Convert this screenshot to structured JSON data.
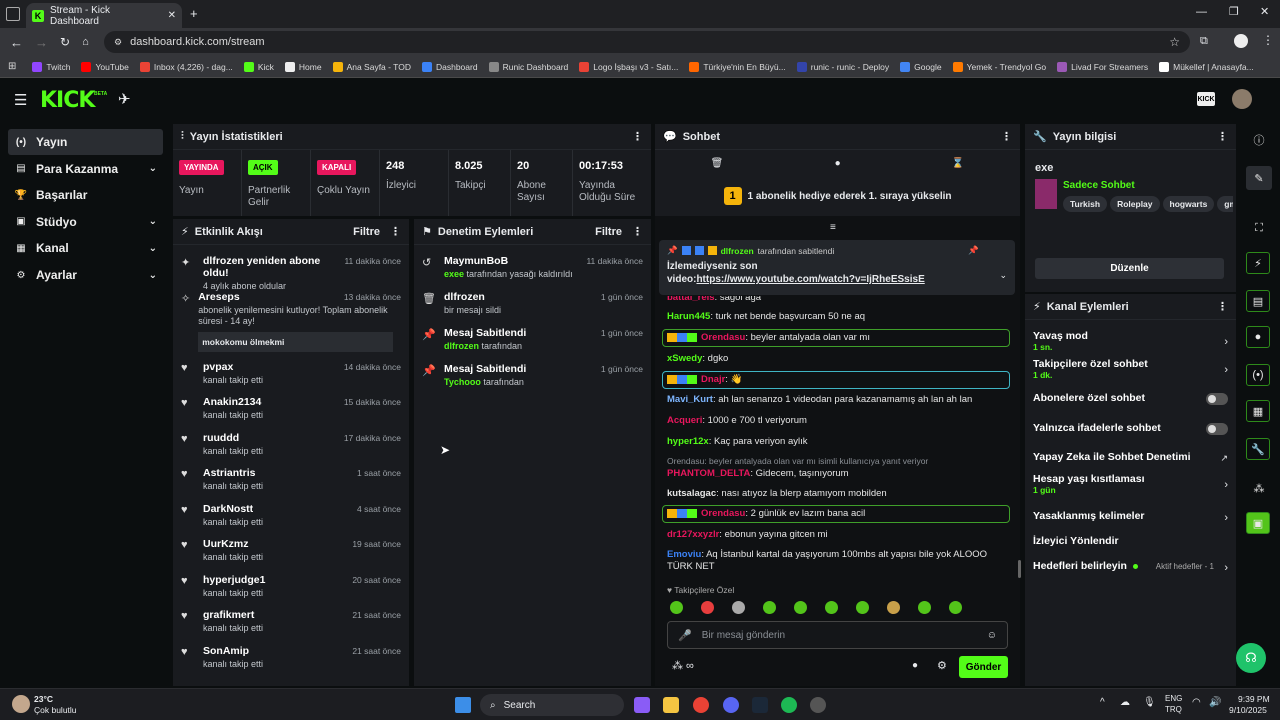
{
  "browser": {
    "tab_title": "Stream - Kick Dashboard",
    "url": "dashboard.kick.com/stream",
    "bookmarks": [
      "Twitch",
      "YouTube",
      "Inbox (4,226) - dag...",
      "Kick",
      "Home",
      "Ana Sayfa - TOD",
      "Dashboard",
      "Runic Dashboard",
      "Logo İşbaşı v3 - Satı...",
      "Türkiye'nin En Büyü...",
      "runic - runic - Deploy",
      "Google",
      "Yemek - Trendyol Go",
      "Livad For Streamers",
      "Mükellef | Anasayfa..."
    ]
  },
  "app": {
    "logo": "KICK",
    "beta": "BETA"
  },
  "sidebar": [
    {
      "label": "Yayın",
      "icon": "broadcast-icon"
    },
    {
      "label": "Para Kazanma",
      "icon": "money-icon"
    },
    {
      "label": "Başarılar",
      "icon": "trophy-icon"
    },
    {
      "label": "Stüdyo",
      "icon": "studio-icon"
    },
    {
      "label": "Kanal",
      "icon": "channel-icon"
    },
    {
      "label": "Ayarlar",
      "icon": "gear-icon"
    }
  ],
  "stats": {
    "title": "Yayın İstatistikleri",
    "items": [
      {
        "badge": "YAYINDA",
        "label": "Yayın",
        "color": "#e8175d"
      },
      {
        "badge": "AÇIK",
        "label": "Partnerlik Gelir",
        "color": "#53fc18"
      },
      {
        "badge": "KAPALI",
        "label": "Çoklu Yayın",
        "color": "#e8175d"
      },
      {
        "value": "248",
        "label": "İzleyici"
      },
      {
        "value": "8.025",
        "label": "Takipçi"
      },
      {
        "value": "20",
        "label": "Abone Sayısı"
      },
      {
        "value": "00:17:53",
        "label": "Yayında Olduğu Süre"
      }
    ]
  },
  "activity": {
    "title": "Etkinlik Akışı",
    "filter": "Filtre",
    "items": [
      {
        "name": "dlfrozen yeniden abone oldu!",
        "sub": "4 aylık abone oldular",
        "time": "11 dakika önce"
      },
      {
        "name": "Areseps",
        "sub": "abonelik yenilemesini kutluyor! Toplam abonelik süresi - 14 ay!",
        "msg": "mokokomu ölmekmi",
        "time": "13 dakika önce"
      },
      {
        "name": "pvpax",
        "sub": "kanalı takip etti",
        "time": "14 dakika önce"
      },
      {
        "name": "Anakin2134",
        "sub": "kanalı takip etti",
        "time": "15 dakika önce"
      },
      {
        "name": "ruuddd",
        "sub": "kanalı takip etti",
        "time": "17 dakika önce"
      },
      {
        "name": "Astriantris",
        "sub": "kanalı takip etti",
        "time": "1 saat önce"
      },
      {
        "name": "DarkNostt",
        "sub": "kanalı takip etti",
        "time": "4 saat önce"
      },
      {
        "name": "UurKzmz",
        "sub": "kanalı takip etti",
        "time": "19 saat önce"
      },
      {
        "name": "hyperjudge1",
        "sub": "kanalı takip etti",
        "time": "20 saat önce"
      },
      {
        "name": "grafikmert",
        "sub": "kanalı takip etti",
        "time": "21 saat önce"
      },
      {
        "name": "SonAmip",
        "sub": "kanalı takip etti",
        "time": "21 saat önce"
      }
    ]
  },
  "moderation": {
    "title": "Denetim Eylemleri",
    "filter": "Filtre",
    "items": [
      {
        "name": "MaymunBoB",
        "user": "exee",
        "sub": " tarafından yasağı kaldırıldı",
        "time": "11 dakika önce",
        "icon": "undo-icon"
      },
      {
        "name": "dlfrozen",
        "user": "",
        "sub": "bir mesajı sildi",
        "time": "1 gün önce",
        "icon": "trash-icon"
      },
      {
        "name": "Mesaj Sabitlendi",
        "user": "dlfrozen",
        "sub": " tarafından",
        "time": "1 gün önce",
        "icon": "pin-icon"
      },
      {
        "name": "Mesaj Sabitlendi",
        "user": "Tychooo",
        "sub": " tarafından",
        "time": "1 gün önce",
        "icon": "pin-icon"
      }
    ]
  },
  "chat": {
    "title": "Sohbet",
    "goal_num": "1",
    "goal_text": "1 abonelik hediye ederek 1. sıraya yükselin",
    "pinned": {
      "by": "dlfrozen",
      "by_suffix": "tarafından sabitlendi",
      "text": "İzlemediyseniz son video:",
      "link": "https://www.youtube.com/watch?v=IjRheESsisE"
    },
    "messages": [
      {
        "user": "battal_reis",
        "color": "#e8175d",
        "text": "sağol aga"
      },
      {
        "user": "Harun445",
        "color": "#53fc18",
        "text": "turk net bende başvurcam 50 ne aq"
      },
      {
        "user": "Orendasu",
        "color": "#e8175d",
        "text": "beyler antalyada olan var mı"
      },
      {
        "user": "xSwedy",
        "color": "#53fc18",
        "text": "dgko"
      },
      {
        "user": "Dnajr",
        "color": "#e8175d",
        "text": "👋"
      },
      {
        "user": "Mavi_Kurt",
        "color": "#7eb6ff",
        "text": "ah lan senanzo 1 videodan para kazanamamış ah lan ah lan"
      },
      {
        "user": "Acqueri",
        "color": "#e8175d",
        "text": "1000 e 700 tl veriyorum"
      },
      {
        "user": "hyper12x",
        "color": "#53fc18",
        "text": "Kaç para veriyon aylık"
      },
      {
        "reply": "Orendasu: beyler antalyada olan var mı isimli kullanıcıya yanıt veriyor",
        "user": "PHANTOM_DELTA",
        "color": "#e8175d",
        "text": "Gidecem, taşınıyorum"
      },
      {
        "user": "kutsalagac",
        "color": "#e6e6e6",
        "text": "nası atıyoz la blerp atamıyom mobilden"
      },
      {
        "user": "Orendasu",
        "color": "#e8175d",
        "text": "2 günlük ev lazım bana acil"
      },
      {
        "user": "dr127xxyzlr",
        "color": "#e8175d",
        "text": "ebonun yayına gitcen mi"
      },
      {
        "user": "Emoviu",
        "color": "#3b82f6",
        "text": "Aq İstanbul kartal da yaşıyorum 100mbs alt yapısı bile yok ALOOO TÜRK NET"
      }
    ],
    "followers_only": "Takipçilere Özel",
    "placeholder": "Bir mesaj gönderin",
    "send": "Gönder"
  },
  "stream_info": {
    "title": "Yayın bilgisi",
    "stream_title": "exe",
    "category": "Sadece Sohbet",
    "tags": [
      "Turkish",
      "Roleplay",
      "hogwarts",
      "gm"
    ],
    "edit": "Düzenle"
  },
  "channel_actions": {
    "title": "Kanal Eylemleri",
    "items": [
      {
        "name": "Yavaş mod",
        "sub": "1 sn.",
        "ctl": "chevron"
      },
      {
        "name": "Takipçilere özel sohbet",
        "sub": "1 dk.",
        "ctl": "chevron"
      },
      {
        "name": "Abonelere özel sohbet",
        "sub": "",
        "ctl": "toggle"
      },
      {
        "name": "Yalnızca ifadelerle sohbet",
        "sub": "",
        "ctl": "toggle"
      },
      {
        "name": "Yapay Zeka ile Sohbet Denetimi",
        "sub": "",
        "ctl": "ext"
      },
      {
        "name": "Hesap yaşı kısıtlaması",
        "sub": "1 gün",
        "ctl": "chevron"
      },
      {
        "name": "Yasaklanmış kelimeler",
        "sub": "",
        "ctl": "chevron"
      },
      {
        "name": "İzleyici Yönlendir",
        "sub": "",
        "ctl": "none"
      },
      {
        "name": "Hedefleri belirleyin",
        "sub": "",
        "ctl": "chevron",
        "extra": "Aktif hedefler - 1"
      }
    ]
  },
  "taskbar": {
    "weather_temp": "23°C",
    "weather_desc": "Çok bulutlu",
    "search": "Search",
    "lang1": "ENG",
    "lang2": "TRQ",
    "time": "9:39 PM",
    "date": "9/10/2025"
  }
}
